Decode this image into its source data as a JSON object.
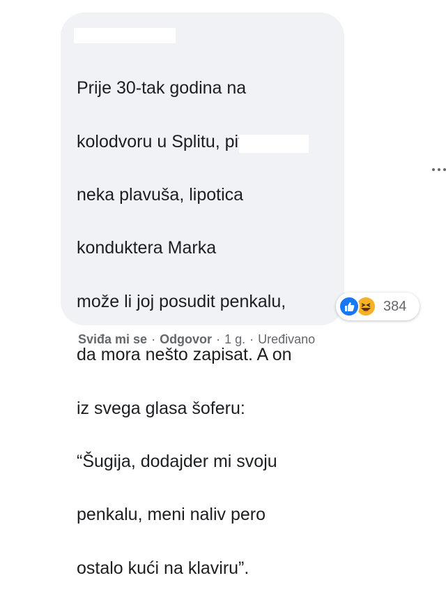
{
  "comment": {
    "author": "",
    "lines": [
      "Prije 30-tak godina na",
      "kolodvoru u Splitu, pita",
      "neka plavuša, lipotica",
      "konduktera Marka",
      "može li joj posudit penkalu,",
      "da mora nešto zapisat. A on",
      "iz svega glasa šoferu:",
      "“Šugija, dodajder mi svoju",
      "penkalu, meni naliv pero",
      "ostalo kući na klaviru”."
    ]
  },
  "reactions": {
    "icons": [
      "like-icon",
      "haha-icon"
    ],
    "count": "384",
    "colors": {
      "like": "#1877f2",
      "haha": "#f7b125"
    }
  },
  "actions": {
    "like": "Sviđa mi se",
    "reply": "Odgovor",
    "time": "1 g.",
    "edited": "Uređivano",
    "separator": "·"
  }
}
